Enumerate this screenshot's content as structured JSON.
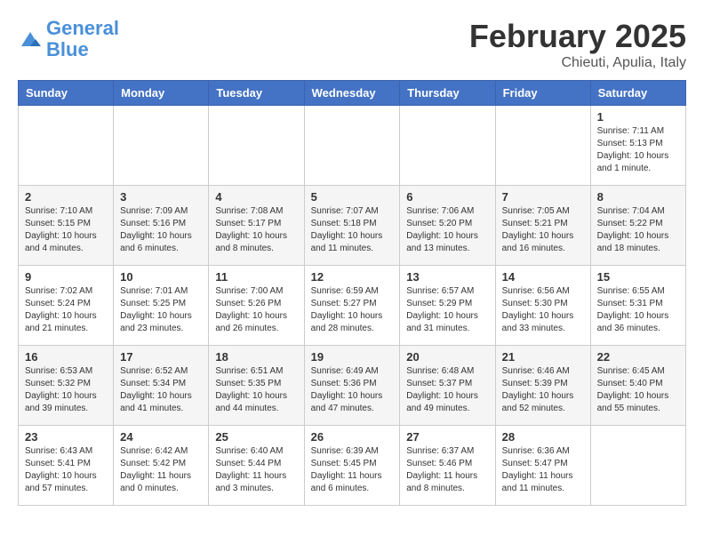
{
  "header": {
    "logo_line1": "General",
    "logo_line2": "Blue",
    "month_title": "February 2025",
    "location": "Chieuti, Apulia, Italy"
  },
  "weekdays": [
    "Sunday",
    "Monday",
    "Tuesday",
    "Wednesday",
    "Thursday",
    "Friday",
    "Saturday"
  ],
  "weeks": [
    [
      {
        "day": "",
        "info": ""
      },
      {
        "day": "",
        "info": ""
      },
      {
        "day": "",
        "info": ""
      },
      {
        "day": "",
        "info": ""
      },
      {
        "day": "",
        "info": ""
      },
      {
        "day": "",
        "info": ""
      },
      {
        "day": "1",
        "info": "Sunrise: 7:11 AM\nSunset: 5:13 PM\nDaylight: 10 hours\nand 1 minute."
      }
    ],
    [
      {
        "day": "2",
        "info": "Sunrise: 7:10 AM\nSunset: 5:15 PM\nDaylight: 10 hours\nand 4 minutes."
      },
      {
        "day": "3",
        "info": "Sunrise: 7:09 AM\nSunset: 5:16 PM\nDaylight: 10 hours\nand 6 minutes."
      },
      {
        "day": "4",
        "info": "Sunrise: 7:08 AM\nSunset: 5:17 PM\nDaylight: 10 hours\nand 8 minutes."
      },
      {
        "day": "5",
        "info": "Sunrise: 7:07 AM\nSunset: 5:18 PM\nDaylight: 10 hours\nand 11 minutes."
      },
      {
        "day": "6",
        "info": "Sunrise: 7:06 AM\nSunset: 5:20 PM\nDaylight: 10 hours\nand 13 minutes."
      },
      {
        "day": "7",
        "info": "Sunrise: 7:05 AM\nSunset: 5:21 PM\nDaylight: 10 hours\nand 16 minutes."
      },
      {
        "day": "8",
        "info": "Sunrise: 7:04 AM\nSunset: 5:22 PM\nDaylight: 10 hours\nand 18 minutes."
      }
    ],
    [
      {
        "day": "9",
        "info": "Sunrise: 7:02 AM\nSunset: 5:24 PM\nDaylight: 10 hours\nand 21 minutes."
      },
      {
        "day": "10",
        "info": "Sunrise: 7:01 AM\nSunset: 5:25 PM\nDaylight: 10 hours\nand 23 minutes."
      },
      {
        "day": "11",
        "info": "Sunrise: 7:00 AM\nSunset: 5:26 PM\nDaylight: 10 hours\nand 26 minutes."
      },
      {
        "day": "12",
        "info": "Sunrise: 6:59 AM\nSunset: 5:27 PM\nDaylight: 10 hours\nand 28 minutes."
      },
      {
        "day": "13",
        "info": "Sunrise: 6:57 AM\nSunset: 5:29 PM\nDaylight: 10 hours\nand 31 minutes."
      },
      {
        "day": "14",
        "info": "Sunrise: 6:56 AM\nSunset: 5:30 PM\nDaylight: 10 hours\nand 33 minutes."
      },
      {
        "day": "15",
        "info": "Sunrise: 6:55 AM\nSunset: 5:31 PM\nDaylight: 10 hours\nand 36 minutes."
      }
    ],
    [
      {
        "day": "16",
        "info": "Sunrise: 6:53 AM\nSunset: 5:32 PM\nDaylight: 10 hours\nand 39 minutes."
      },
      {
        "day": "17",
        "info": "Sunrise: 6:52 AM\nSunset: 5:34 PM\nDaylight: 10 hours\nand 41 minutes."
      },
      {
        "day": "18",
        "info": "Sunrise: 6:51 AM\nSunset: 5:35 PM\nDaylight: 10 hours\nand 44 minutes."
      },
      {
        "day": "19",
        "info": "Sunrise: 6:49 AM\nSunset: 5:36 PM\nDaylight: 10 hours\nand 47 minutes."
      },
      {
        "day": "20",
        "info": "Sunrise: 6:48 AM\nSunset: 5:37 PM\nDaylight: 10 hours\nand 49 minutes."
      },
      {
        "day": "21",
        "info": "Sunrise: 6:46 AM\nSunset: 5:39 PM\nDaylight: 10 hours\nand 52 minutes."
      },
      {
        "day": "22",
        "info": "Sunrise: 6:45 AM\nSunset: 5:40 PM\nDaylight: 10 hours\nand 55 minutes."
      }
    ],
    [
      {
        "day": "23",
        "info": "Sunrise: 6:43 AM\nSunset: 5:41 PM\nDaylight: 10 hours\nand 57 minutes."
      },
      {
        "day": "24",
        "info": "Sunrise: 6:42 AM\nSunset: 5:42 PM\nDaylight: 11 hours\nand 0 minutes."
      },
      {
        "day": "25",
        "info": "Sunrise: 6:40 AM\nSunset: 5:44 PM\nDaylight: 11 hours\nand 3 minutes."
      },
      {
        "day": "26",
        "info": "Sunrise: 6:39 AM\nSunset: 5:45 PM\nDaylight: 11 hours\nand 6 minutes."
      },
      {
        "day": "27",
        "info": "Sunrise: 6:37 AM\nSunset: 5:46 PM\nDaylight: 11 hours\nand 8 minutes."
      },
      {
        "day": "28",
        "info": "Sunrise: 6:36 AM\nSunset: 5:47 PM\nDaylight: 11 hours\nand 11 minutes."
      },
      {
        "day": "",
        "info": ""
      }
    ]
  ]
}
